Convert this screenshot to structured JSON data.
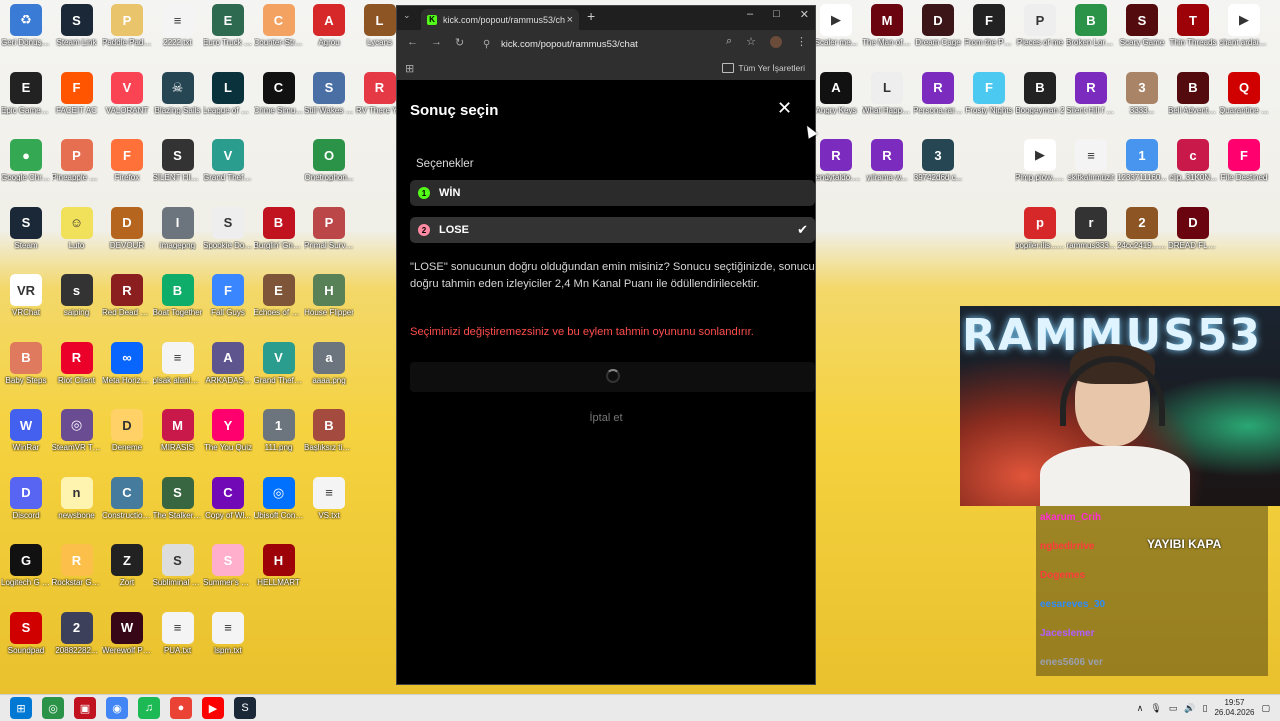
{
  "desktop": {
    "icons": [
      {
        "label": "Geri Dönüşü...",
        "color": "#3a7bd5",
        "glyph": "♻",
        "col": 0,
        "row": 0
      },
      {
        "label": "Steam Link",
        "color": "#1b2838",
        "glyph": "S",
        "col": 1,
        "row": 0
      },
      {
        "label": "Paddle Paddl...",
        "color": "#e9c46a",
        "glyph": "P",
        "col": 2,
        "row": 0
      },
      {
        "label": "2222.txt",
        "color": "#f4f4f4",
        "glyph": "≡",
        "col": 3,
        "row": 0
      },
      {
        "label": "Euro Truck Simulator 2",
        "color": "#2d6a4f",
        "glyph": "E",
        "col": 4,
        "row": 0
      },
      {
        "label": "Counter-Str... 2",
        "color": "#f4a261",
        "glyph": "C",
        "col": 5,
        "row": 0
      },
      {
        "label": "Agrou",
        "color": "#d62828",
        "glyph": "A",
        "col": 6,
        "row": 0
      },
      {
        "label": "Lycans",
        "color": "#8d5524",
        "glyph": "L",
        "col": 7,
        "row": 0
      },
      {
        "label": "Epic Games Launcher",
        "color": "#222",
        "glyph": "E",
        "col": 0,
        "row": 1
      },
      {
        "label": "FACEIT AC",
        "color": "#ff5500",
        "glyph": "F",
        "col": 1,
        "row": 1
      },
      {
        "label": "VALORANT",
        "color": "#fa4454",
        "glyph": "V",
        "col": 2,
        "row": 1
      },
      {
        "label": "Blazing Sails",
        "color": "#264653",
        "glyph": "☠",
        "col": 3,
        "row": 1
      },
      {
        "label": "League of Legends",
        "color": "#0a323c",
        "glyph": "L",
        "col": 4,
        "row": 1
      },
      {
        "label": "Crime Simulator",
        "color": "#111",
        "glyph": "C",
        "col": 5,
        "row": 1
      },
      {
        "label": "Still Wakes the Deep",
        "color": "#4a6fa5",
        "glyph": "S",
        "col": 6,
        "row": 1
      },
      {
        "label": "RV There Y...",
        "color": "#e63946",
        "glyph": "R",
        "col": 7,
        "row": 1
      },
      {
        "label": "Google Chrome",
        "color": "#34a853",
        "glyph": "●",
        "col": 0,
        "row": 2
      },
      {
        "label": "Pineapple on pizza",
        "color": "#e76f51",
        "glyph": "P",
        "col": 1,
        "row": 2
      },
      {
        "label": "Firefox",
        "color": "#ff7139",
        "glyph": "F",
        "col": 2,
        "row": 2
      },
      {
        "label": "SILENT HILL f",
        "color": "#333",
        "glyph": "S",
        "col": 3,
        "row": 2
      },
      {
        "label": "Grand Theft Auto V En...",
        "color": "#2a9d8f",
        "glyph": "V",
        "col": 4,
        "row": 2
      },
      {
        "label": "Onetrophon...",
        "color": "#2b9348",
        "glyph": "O",
        "col": 6,
        "row": 2
      },
      {
        "label": "Steam",
        "color": "#1b2838",
        "glyph": "S",
        "col": 0,
        "row": 3
      },
      {
        "label": "Luto",
        "color": "#f1e05a",
        "glyph": "☺",
        "col": 1,
        "row": 3
      },
      {
        "label": "DEVOUR",
        "color": "#b5651d",
        "glyph": "D",
        "col": 2,
        "row": 3
      },
      {
        "label": "imagepng",
        "color": "#6c757d",
        "glyph": "I",
        "col": 3,
        "row": 3
      },
      {
        "label": "Spookie Dookie",
        "color": "#eee",
        "glyph": "S",
        "col": 4,
        "row": 3
      },
      {
        "label": "Burglin' Gnom...",
        "color": "#c1121f",
        "glyph": "B",
        "col": 5,
        "row": 3
      },
      {
        "label": "Primal Surviv...",
        "color": "#bc4749",
        "glyph": "P",
        "col": 6,
        "row": 3
      },
      {
        "label": "VRChat",
        "color": "#fff",
        "glyph": "VR",
        "col": 0,
        "row": 4
      },
      {
        "label": "saiping",
        "color": "#333",
        "glyph": "s",
        "col": 1,
        "row": 4
      },
      {
        "label": "Red Dead Redempti...",
        "color": "#8b1e1e",
        "glyph": "R",
        "col": 2,
        "row": 4
      },
      {
        "label": "Boat Together",
        "color": "#0ead69",
        "glyph": "B",
        "col": 3,
        "row": 4
      },
      {
        "label": "Fall Guys",
        "color": "#3a86ff",
        "glyph": "F",
        "col": 4,
        "row": 4
      },
      {
        "label": "Echoes of Elysium",
        "color": "#7f5539",
        "glyph": "E",
        "col": 5,
        "row": 4
      },
      {
        "label": "House Flipper",
        "color": "#588157",
        "glyph": "H",
        "col": 6,
        "row": 4
      },
      {
        "label": "Baby Steps",
        "color": "#e07a5f",
        "glyph": "B",
        "col": 0,
        "row": 5
      },
      {
        "label": "Riot Client",
        "color": "#eb0029",
        "glyph": "R",
        "col": 1,
        "row": 5
      },
      {
        "label": "Meta Horizon Link",
        "color": "#0866ff",
        "glyph": "∞",
        "col": 2,
        "row": 5
      },
      {
        "label": "plsak alanlarıtxt",
        "color": "#f4f4f4",
        "glyph": "≡",
        "col": 3,
        "row": 5
      },
      {
        "label": "ARKADAŞ...",
        "color": "#5e548e",
        "glyph": "A",
        "col": 4,
        "row": 5
      },
      {
        "label": "Grand Theft Auto V Le...",
        "color": "#2a9d8f",
        "glyph": "V",
        "col": 5,
        "row": 5
      },
      {
        "label": "aaaa.png",
        "color": "#6c757d",
        "glyph": "a",
        "col": 6,
        "row": 5
      },
      {
        "label": "WinRar",
        "color": "#4361ee",
        "glyph": "W",
        "col": 0,
        "row": 6
      },
      {
        "label": "SteamVR Tracker",
        "color": "#6a4c93",
        "glyph": "◎",
        "col": 1,
        "row": 6
      },
      {
        "label": "Deneme",
        "color": "#ffd166",
        "glyph": "D",
        "col": 2,
        "row": 6
      },
      {
        "label": "MIRASIS",
        "color": "#c9184a",
        "glyph": "M",
        "col": 3,
        "row": 6
      },
      {
        "label": "The You Quiz",
        "color": "#ff006e",
        "glyph": "Y",
        "col": 4,
        "row": 6
      },
      {
        "label": "111.png",
        "color": "#6c757d",
        "glyph": "1",
        "col": 5,
        "row": 6
      },
      {
        "label": "Başlıksız tipi...",
        "color": "#a44a3f",
        "glyph": "B",
        "col": 6,
        "row": 6
      },
      {
        "label": "Discord",
        "color": "#5865f2",
        "glyph": "D",
        "col": 0,
        "row": 7
      },
      {
        "label": "newsbone",
        "color": "#fff3b0",
        "glyph": "n",
        "col": 1,
        "row": 7
      },
      {
        "label": "Construction Simulator",
        "color": "#457b9d",
        "glyph": "C",
        "col": 2,
        "row": 7
      },
      {
        "label": "The Stalker 3 Demo",
        "color": "#386641",
        "glyph": "S",
        "col": 3,
        "row": 7
      },
      {
        "label": "Copy of Wl...",
        "color": "#7209b7",
        "glyph": "C",
        "col": 4,
        "row": 7
      },
      {
        "label": "Ubisoft Connect",
        "color": "#0070ff",
        "glyph": "◎",
        "col": 5,
        "row": 7
      },
      {
        "label": "VS.txt",
        "color": "#f4f4f4",
        "glyph": "≡",
        "col": 6,
        "row": 7
      },
      {
        "label": "Logitech G HUB",
        "color": "#111",
        "glyph": "G",
        "col": 0,
        "row": 8
      },
      {
        "label": "Rockstar Games...",
        "color": "#fcbf49",
        "glyph": "R",
        "col": 1,
        "row": 8
      },
      {
        "label": "Zort",
        "color": "#222",
        "glyph": "Z",
        "col": 2,
        "row": 8
      },
      {
        "label": "Subliminal Demo",
        "color": "#ddd",
        "glyph": "S",
        "col": 3,
        "row": 8
      },
      {
        "label": "Summer's Heartbeat",
        "color": "#ffafcc",
        "glyph": "S",
        "col": 4,
        "row": 8
      },
      {
        "label": "HELLMART",
        "color": "#9d0208",
        "glyph": "H",
        "col": 5,
        "row": 8
      },
      {
        "label": "Soundpad",
        "color": "#d00000",
        "glyph": "S",
        "col": 0,
        "row": 9
      },
      {
        "label": "20882282...",
        "color": "#3d405b",
        "glyph": "2",
        "col": 1,
        "row": 9
      },
      {
        "label": "Werewolf Party",
        "color": "#370617",
        "glyph": "W",
        "col": 2,
        "row": 9
      },
      {
        "label": "PUA.txt",
        "color": "#f4f4f4",
        "glyph": "≡",
        "col": 3,
        "row": 9
      },
      {
        "label": "lspm.txt",
        "color": "#f4f4f4",
        "glyph": "≡",
        "col": 4,
        "row": 9
      }
    ],
    "right_icons": [
      {
        "label": "Scaler me...",
        "color": "#fff",
        "glyph": "▶",
        "col": 0,
        "row": 0
      },
      {
        "label": "The Man of Jonah",
        "color": "#6a040f",
        "glyph": "M",
        "col": 1,
        "row": 0
      },
      {
        "label": "Dream Cage",
        "color": "#3c1518",
        "glyph": "D",
        "col": 2,
        "row": 0
      },
      {
        "label": "From the Past",
        "color": "#222",
        "glyph": "F",
        "col": 3,
        "row": 0
      },
      {
        "label": "Pieces of me",
        "color": "#eee",
        "glyph": "P",
        "col": 4,
        "row": 0
      },
      {
        "label": "Broken Lore DON'T W...",
        "color": "#2b9348",
        "glyph": "B",
        "col": 5,
        "row": 0
      },
      {
        "label": "Scary Game",
        "color": "#540b0e",
        "glyph": "S",
        "col": 6,
        "row": 0
      },
      {
        "label": "Thin Threads",
        "color": "#9d0208",
        "glyph": "T",
        "col": 7,
        "row": 0
      },
      {
        "label": "chant ardaintMP3",
        "color": "#fff",
        "glyph": "▶",
        "col": 8,
        "row": 0
      },
      {
        "label": "Angry Keys",
        "color": "#111",
        "glyph": "A",
        "col": 0,
        "row": 1
      },
      {
        "label": "What Happened...",
        "color": "#eee",
        "glyph": "L",
        "col": 1,
        "row": 1
      },
      {
        "label": "Persona.rar No REM...",
        "color": "#7b2cbf",
        "glyph": "R",
        "col": 2,
        "row": 1
      },
      {
        "label": "Frosty Nights",
        "color": "#4cc9f0",
        "glyph": "F",
        "col": 3,
        "row": 1
      },
      {
        "label": "Boogeyman 2",
        "color": "#222",
        "glyph": "B",
        "col": 4,
        "row": 1
      },
      {
        "label": "Silent Hill f Türkçe Ya...",
        "color": "#7b2cbf",
        "glyph": "R",
        "col": 5,
        "row": 1
      },
      {
        "label": "3333...",
        "color": "#a98467",
        "glyph": "3",
        "col": 6,
        "row": 1
      },
      {
        "label": "Bell Adventure",
        "color": "#540b0e",
        "glyph": "B",
        "col": 7,
        "row": 1
      },
      {
        "label": "Quarantine Zone The...",
        "color": "#d00000",
        "glyph": "Q",
        "col": 8,
        "row": 1
      },
      {
        "label": "bendytaldo... Records.zip",
        "color": "#7b2cbf",
        "glyph": "R",
        "col": 0,
        "row": 2
      },
      {
        "label": "yılrama w...",
        "color": "#7b2cbf",
        "glyph": "R",
        "col": 1,
        "row": 2
      },
      {
        "label": "39742d6d c...",
        "color": "#264653",
        "glyph": "3",
        "col": 2,
        "row": 2
      },
      {
        "label": "Pimp piow... (1).mp3",
        "color": "#fff",
        "glyph": "▶",
        "col": 4,
        "row": 2
      },
      {
        "label": "skitkalırmüzit",
        "color": "#f4f4f4",
        "glyph": "≡",
        "col": 5,
        "row": 2
      },
      {
        "label": "1233711160...",
        "color": "#4895ef",
        "glyph": "1",
        "col": 6,
        "row": 2
      },
      {
        "label": "clip_31K0N...",
        "color": "#c9184a",
        "glyph": "c",
        "col": 7,
        "row": 2
      },
      {
        "label": "File Destined",
        "color": "#ff006e",
        "glyph": "F",
        "col": 8,
        "row": 2
      },
      {
        "label": "popiler.ilis... (3).gif",
        "color": "#d62828",
        "glyph": "p",
        "col": 4,
        "row": 3
      },
      {
        "label": "rammus333...",
        "color": "#333",
        "glyph": "r",
        "col": 5,
        "row": 3
      },
      {
        "label": "24cc2419... b...",
        "color": "#8d5524",
        "glyph": "2",
        "col": 6,
        "row": 3
      },
      {
        "label": "DREAD FLATS",
        "color": "#6a040f",
        "glyph": "D",
        "col": 7,
        "row": 3
      }
    ]
  },
  "browser": {
    "tab_title": "kick.com/popout/rammus53/ch",
    "tab_favicon": "K",
    "new_tab_glyph": "+",
    "url": "kick.com/popout/rammus53/chat",
    "bookmarks_all_label": "Tüm Yer İşaretleri"
  },
  "dialog": {
    "title": "Sonuç seçin",
    "section_label": "Seçenekler",
    "options": [
      {
        "number": "1",
        "label": "WİN",
        "color": "#53fc18",
        "selected": false
      },
      {
        "number": "2",
        "label": "LOSE",
        "color": "#ff8aa1",
        "selected": true
      }
    ],
    "confirm_text": "\"LOSE\" sonucunun doğru olduğundan emin misiniz? Sonucu seçtiğinizde, sonucu doğru tahmin eden izleyiciler 2,4 Mn Kanal Puanı ile ödüllendirilecektir.",
    "warning_text": "Seçiminizi değiştiremezsiniz ve bu eylem tahmin oyununu sonlandırır.",
    "cancel_label": "İptal et",
    "colors": {
      "warning": "#ff4d4d",
      "accent": "#53fc18"
    }
  },
  "stream": {
    "cam_text": "RAMMUS53",
    "overlay_button": "YAYIBI KAPA",
    "chat": [
      {
        "user": "akarum_Crih",
        "color": "#ff2bd6"
      },
      {
        "user": "ngbedirrive",
        "color": "#ff3b3b"
      },
      {
        "user": "Dogemes",
        "color": "#ff3b3b"
      },
      {
        "user": "eesareves_30",
        "color": "#2b8cff"
      },
      {
        "user": "Jaceslemer",
        "color": "#b55dff"
      },
      {
        "user": "enes5606 ver",
        "color": "#9aa0b0"
      }
    ]
  },
  "taskbar": {
    "time": "19:57",
    "date": "26.04.2026",
    "items": [
      {
        "name": "windows-start-icon",
        "glyph": "⊞",
        "color": "#0078d4"
      },
      {
        "name": "app-1-icon",
        "glyph": "◎",
        "color": "#2b9348"
      },
      {
        "name": "app-2-icon",
        "glyph": "▣",
        "color": "#c1121f"
      },
      {
        "name": "app-3-icon",
        "glyph": "◉",
        "color": "#4285f4"
      },
      {
        "name": "spotify-icon",
        "glyph": "♫",
        "color": "#1db954"
      },
      {
        "name": "chrome-icon",
        "glyph": "●",
        "color": "#ea4335"
      },
      {
        "name": "youtube-icon",
        "glyph": "▶",
        "color": "#ff0000"
      },
      {
        "name": "steam-icon",
        "glyph": "S",
        "color": "#1b2838"
      }
    ]
  }
}
